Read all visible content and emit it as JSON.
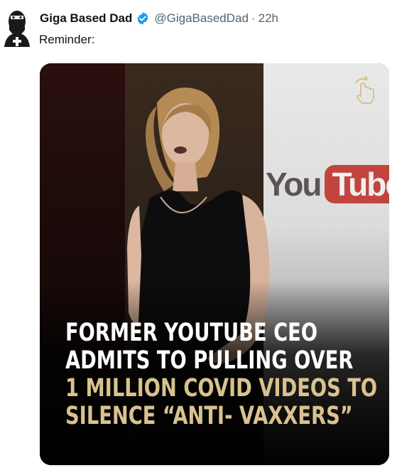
{
  "tweet": {
    "author_name": "Giga Based Dad",
    "handle": "@GigaBasedDad",
    "separator": "·",
    "time": "22h",
    "text": "Reminder:",
    "verified_color": "#1d9bf0"
  },
  "media": {
    "headline_lines": [
      {
        "text": "FORMER YOUTUBE CEO",
        "color": "#ffffff"
      },
      {
        "text": "ADMITS TO PULLING OVER",
        "color": "#ffffff"
      },
      {
        "text": "1 MILLION COVID VIDEOS TO",
        "color": "#d9c28f"
      },
      {
        "text": "SILENCE “ANTI- VAXXERS”",
        "color": "#d9c28f"
      }
    ],
    "background_sign": {
      "word1": "You",
      "word2": "Tube",
      "brand_color": "#c1453d"
    },
    "icons": [
      "avatar",
      "verified-badge-icon",
      "swipe-hand-icon"
    ]
  }
}
